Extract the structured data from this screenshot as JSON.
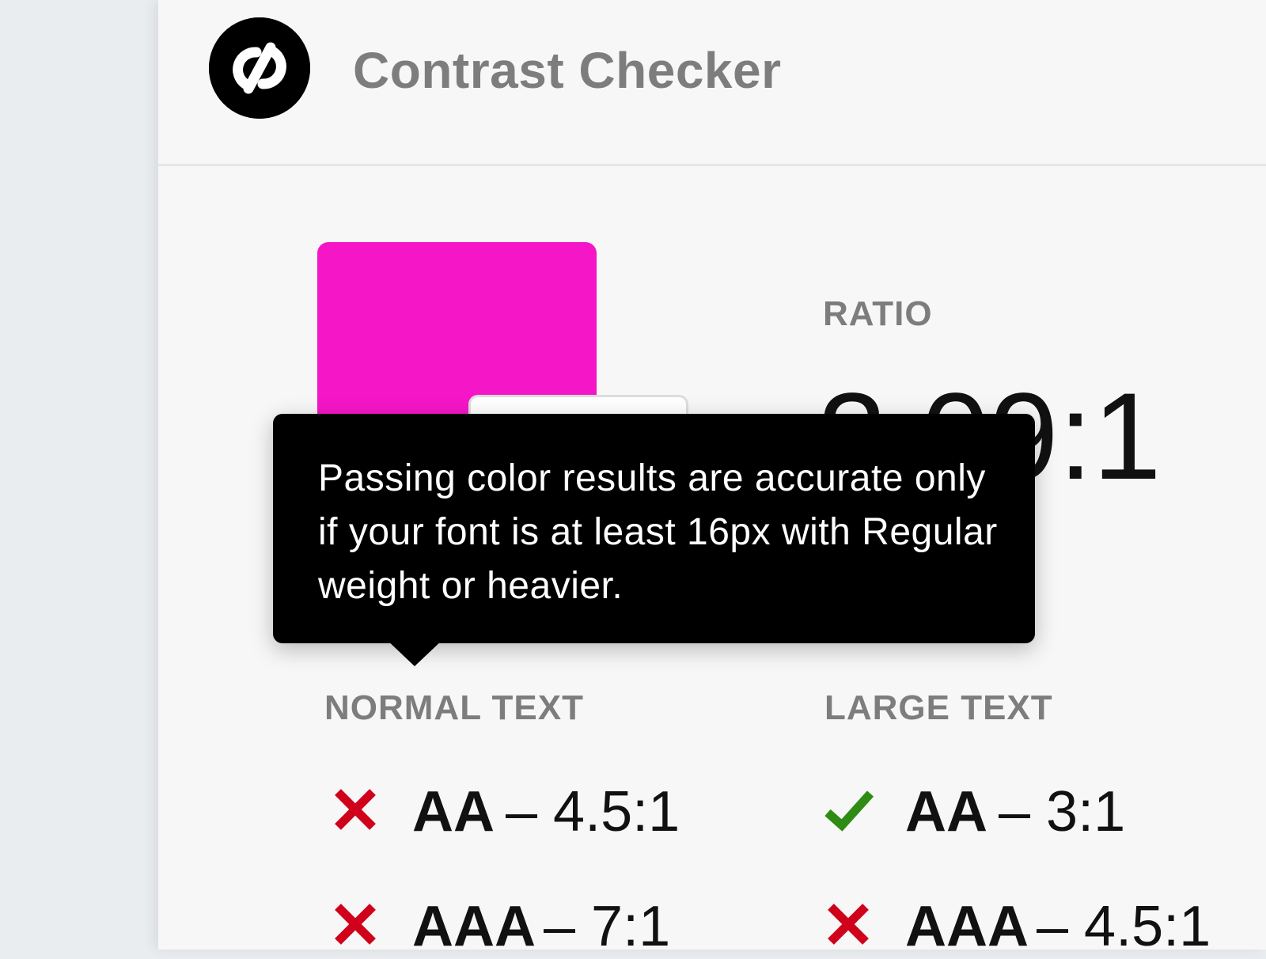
{
  "app": {
    "title": "Contrast Checker",
    "logo_icon": "contrast-logo-icon"
  },
  "colors": {
    "foreground": "#f516c7",
    "background": "#ffffff",
    "fail": "#d0021b",
    "pass": "#2e8b13"
  },
  "ratio": {
    "label": "RATIO",
    "value": "3.09:1"
  },
  "tooltip": {
    "text": "Passing color results are accurate only if your font is at least 16px with Regular weight or heavier."
  },
  "normal_text": {
    "heading": "NORMAL TEXT",
    "results": [
      {
        "level": "AA",
        "requirement": "– 4.5:1",
        "status": "fail",
        "icon": "x-icon"
      },
      {
        "level": "AAA",
        "requirement": "– 7:1",
        "status": "fail",
        "icon": "x-icon"
      }
    ]
  },
  "large_text": {
    "heading": "LARGE TEXT",
    "results": [
      {
        "level": "AA",
        "requirement": "– 3:1",
        "status": "pass",
        "icon": "check-icon"
      },
      {
        "level": "AAA",
        "requirement": "– 4.5:1",
        "status": "fail",
        "icon": "x-icon"
      }
    ]
  }
}
